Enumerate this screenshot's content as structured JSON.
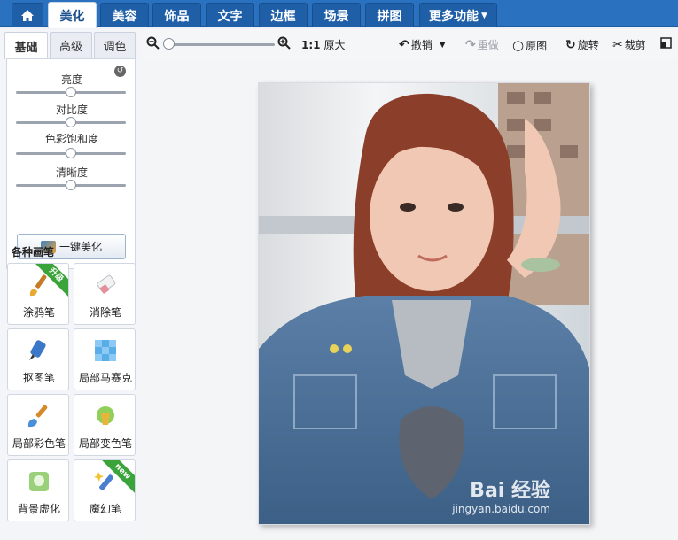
{
  "top_tabs": [
    {
      "label": "",
      "icon": "home-icon"
    },
    {
      "label": "美化"
    },
    {
      "label": "美容"
    },
    {
      "label": "饰品"
    },
    {
      "label": "文字"
    },
    {
      "label": "边框"
    },
    {
      "label": "场景"
    },
    {
      "label": "拼图"
    },
    {
      "label": "更多功能"
    }
  ],
  "sub_tabs": [
    "基础",
    "高级",
    "调色"
  ],
  "adjustments": [
    {
      "label": "亮度",
      "value": 0.5
    },
    {
      "label": "对比度",
      "value": 0.5
    },
    {
      "label": "色彩饱和度",
      "value": 0.5
    },
    {
      "label": "清晰度",
      "value": 0.5
    }
  ],
  "one_click_label": "一键美化",
  "brushes_title": "各种画笔",
  "brushes": [
    {
      "label": "涂鸦笔",
      "badge": "升级",
      "icon": "paintbrush-icon"
    },
    {
      "label": "消除笔",
      "badge": "",
      "icon": "eraser-icon"
    },
    {
      "label": "抠图笔",
      "badge": "",
      "icon": "cutout-pen-icon"
    },
    {
      "label": "局部马赛克",
      "badge": "",
      "icon": "mosaic-icon"
    },
    {
      "label": "局部彩色笔",
      "badge": "",
      "icon": "color-brush-icon"
    },
    {
      "label": "局部变色笔",
      "badge": "",
      "icon": "color-change-pen-icon"
    },
    {
      "label": "背景虚化",
      "badge": "",
      "icon": "background-blur-icon"
    },
    {
      "label": "魔幻笔",
      "badge": "new",
      "icon": "magic-pen-icon"
    }
  ],
  "toolbar": {
    "zoom_level": 0.05,
    "actual_size": "1:1",
    "original_size": "原大",
    "undo": "撤销",
    "redo": "重做",
    "original": "原图",
    "rotate": "旋转",
    "crop": "裁剪"
  },
  "watermark": {
    "line1": "Bai 经验",
    "line2": "jingyan.baidu.com"
  },
  "colors": {
    "accent": "#2a72c0",
    "badge_green": "#3aa43a"
  }
}
